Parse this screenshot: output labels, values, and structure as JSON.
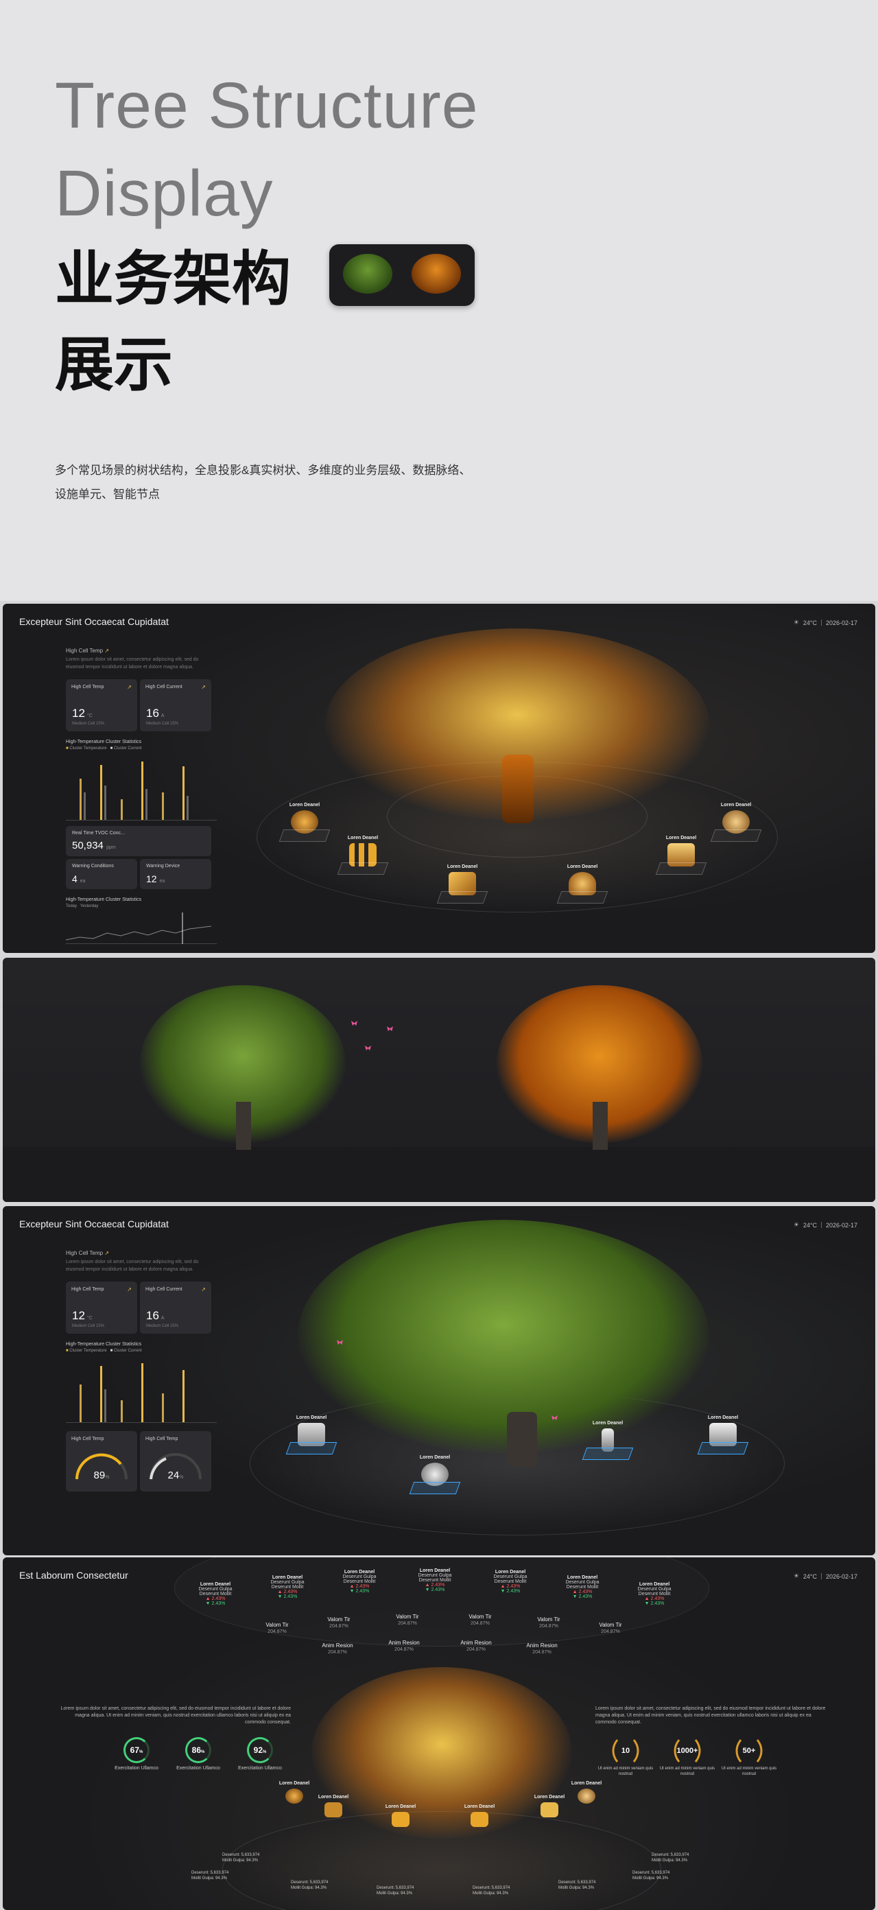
{
  "hero": {
    "title_en": "Tree Structure\nDisplay",
    "title_cn": "业务架构\n展示",
    "description": "多个常见场景的树状结构，全息投影&真实树状、多维度的业务层级、数据脉络、\n设施单元、智能节点"
  },
  "weather": {
    "temp": "24°C",
    "date": "2026-02-17"
  },
  "panel1": {
    "title": "Excepteur Sint Occaecat Cupidatat",
    "section_label": "High Cell Temp",
    "section_sub": "Lorem ipsum dolor sit amet, consectetur adipiscing elit, sed do eiusmod tempor incididunt ut labore et dolore magna aliqua.",
    "cards": [
      {
        "title": "High Cell Temp",
        "value": "12",
        "unit": "°C",
        "sub": "Medium Cell 15%"
      },
      {
        "title": "High Cell Current",
        "value": "16",
        "unit": "A",
        "sub": "Medium Cell 15%"
      }
    ],
    "chart_title": "High-Temperature Cluster Statistics",
    "legend": [
      "Cluster Temperature",
      "Cluster Current"
    ],
    "realtime": {
      "title": "Real Time TVOC Conc...",
      "value": "50,934",
      "unit": "ppm"
    },
    "warning": {
      "title": "Warning Conditions",
      "value": "4",
      "unit": "ea"
    },
    "warning2": {
      "title": "Warning Device",
      "value": "12",
      "unit": "ea"
    },
    "chart2_title": "High-Temperature Cluster Statistics",
    "legend2": [
      "Today",
      "Yesterday"
    ],
    "node_label": "Loren Deanel"
  },
  "panel3": {
    "title": "Excepteur Sint Occaecat Cupidatat",
    "gauges": [
      {
        "title": "High Cell Temp",
        "value": "89",
        "unit": "%"
      },
      {
        "title": "High Cell Temp",
        "value": "24",
        "unit": "%"
      }
    ]
  },
  "panel4": {
    "title": "Est Laborum Consectetur",
    "ring_top": [
      {
        "name": "Loren Deanel",
        "l1": "Deserunt Gulpa",
        "l2": "Deserunt Mollit",
        "up": "▲ 2.43%",
        "dn": "▼ 2.43%"
      }
    ],
    "valom": {
      "name": "Valom Tir",
      "value": "204.87%"
    },
    "anim": {
      "name": "Anim Resion",
      "value": "204.87%"
    },
    "para_left": "Lorem ipsum dolor sit amet, consectetur adipiscing elit, sed do eiusmod tempor incididunt ut labore et dolore magna aliqua. Ut enim ad minim veniam, quis nostrud exercitation ullamco laboris nisi ut aliquip ex ea commodo consequat.",
    "para_right": "Lorem ipsum dolor sit amet, consectetur adipiscing elit, sed do eiusmod tempor incididunt ut labore et dolore magna aliqua. Ut enim ad minim veniam, quis nostrud exercitation ullamco laboris nisi ut aliquip ex ea commodo consequat.",
    "rings": [
      {
        "value": "67",
        "unit": "%",
        "label": "Exercitation Ullamco"
      },
      {
        "value": "86",
        "unit": "%",
        "label": "Exercitation Ullamco"
      },
      {
        "value": "92",
        "unit": "%",
        "label": "Exercitation Ullamco"
      }
    ],
    "laurels": [
      {
        "value": "10",
        "label": "Ut enim ad minim veniam quis nostrud"
      },
      {
        "value": "1000+",
        "label": "Ut enim ad minim veniam quis nostrud"
      },
      {
        "value": "50+",
        "label": "Ut enim ad minim veniam quis nostrud"
      }
    ],
    "bottom": {
      "l1": "Deserunt: 5,633,974",
      "l2": "Mollit Gulpa: 94.3%"
    }
  },
  "colors": {
    "gold": "#e8a62a",
    "green": "#4f7a22",
    "orange": "#c9650f",
    "up": "#ff5a5a",
    "down": "#43d17a"
  }
}
